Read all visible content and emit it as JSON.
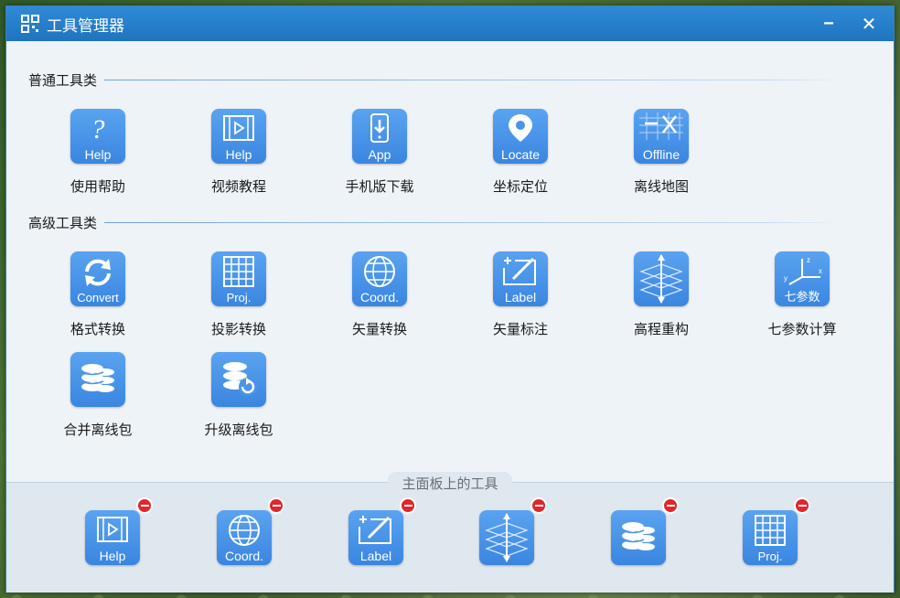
{
  "window": {
    "title": "工具管理器",
    "minimize_glyph": "−",
    "close_glyph": "✕"
  },
  "colors": {
    "titlebar": "#2a82d0",
    "icon_bg": "#4a94e8",
    "remove_badge": "#e2262a",
    "section_line": "#6fa4e0"
  },
  "sections": [
    {
      "title": "普通工具类",
      "tools": [
        {
          "label": "使用帮助",
          "icon": "help-icon",
          "caption": "Help"
        },
        {
          "label": "视频教程",
          "icon": "video-icon",
          "caption": "Help"
        },
        {
          "label": "手机版下载",
          "icon": "phone-download-icon",
          "caption": "App"
        },
        {
          "label": "坐标定位",
          "icon": "location-pin-icon",
          "caption": "Locate"
        },
        {
          "label": "离线地图",
          "icon": "offline-map-icon",
          "caption": "Offline"
        }
      ]
    },
    {
      "title": "高级工具类",
      "tools": [
        {
          "label": "格式转换",
          "icon": "convert-icon",
          "caption": "Convert"
        },
        {
          "label": "投影转换",
          "icon": "projection-grid-icon",
          "caption": "Proj."
        },
        {
          "label": "矢量转换",
          "icon": "globe-icon",
          "caption": "Coord."
        },
        {
          "label": "矢量标注",
          "icon": "label-edit-icon",
          "caption": "Label"
        },
        {
          "label": "高程重构",
          "icon": "elevation-layers-icon",
          "caption": ""
        },
        {
          "label": "七参数计算",
          "icon": "axes-icon",
          "caption": "七参数"
        },
        {
          "label": "合并离线包",
          "icon": "database-icon",
          "caption": ""
        },
        {
          "label": "升级离线包",
          "icon": "database-refresh-icon",
          "caption": ""
        }
      ]
    }
  ],
  "bottom_panel": {
    "title": "主面板上的工具",
    "tools": [
      {
        "icon": "video-icon",
        "caption": "Help"
      },
      {
        "icon": "globe-icon",
        "caption": "Coord."
      },
      {
        "icon": "label-edit-icon",
        "caption": "Label"
      },
      {
        "icon": "elevation-layers-icon",
        "caption": ""
      },
      {
        "icon": "database-icon",
        "caption": ""
      },
      {
        "icon": "projection-grid-icon",
        "caption": "Proj."
      }
    ]
  }
}
